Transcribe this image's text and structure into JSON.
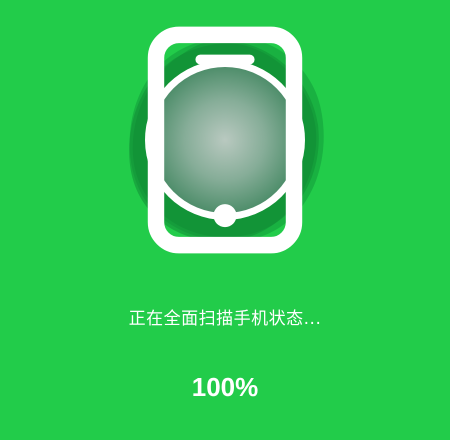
{
  "scan": {
    "status_text": "正在全面扫描手机状态...",
    "progress_text": "100%",
    "progress": 1.0
  },
  "icons": {
    "center": "smartphone-icon"
  },
  "colors": {
    "background": "#22cc4a",
    "blob_dark": "#139a3a",
    "ring": "#ffffff",
    "inner_circle": "#7fae97"
  }
}
